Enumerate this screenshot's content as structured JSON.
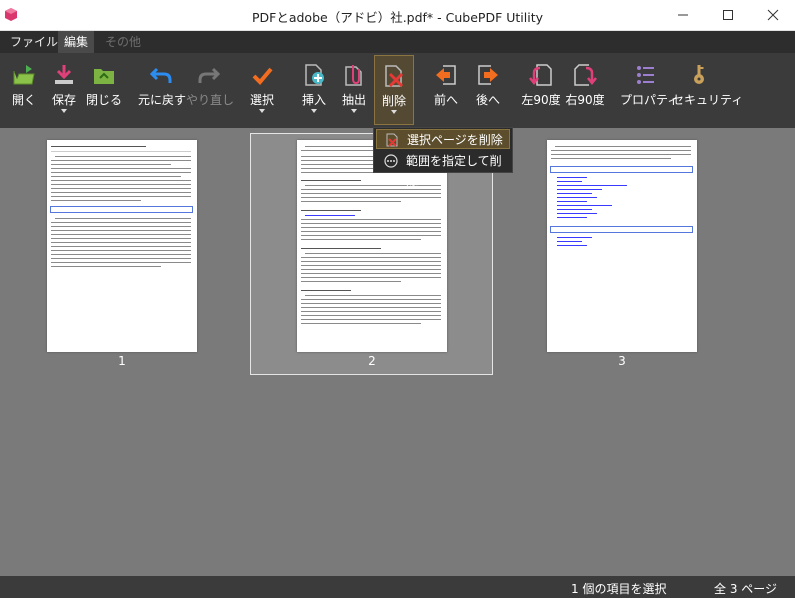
{
  "window": {
    "title": "PDFとadobe（アドビ）社.pdf* - CubePDF Utility",
    "minimize_icon": "minimize-icon",
    "maximize_icon": "maximize-icon",
    "close_icon": "close-icon"
  },
  "menubar": {
    "items": [
      {
        "label": "ファイル"
      },
      {
        "label": "編集"
      },
      {
        "label": "その他"
      }
    ]
  },
  "ribbon": {
    "open": "開く",
    "save": "保存",
    "close": "閉じる",
    "undo": "元に戻す",
    "redo": "やり直し",
    "select": "選択",
    "insert": "挿入",
    "extract": "抽出",
    "delete": "削除",
    "move_prev": "前へ",
    "move_next": "後へ",
    "rotate_left": "左90度",
    "rotate_right": "右90度",
    "properties": "プロパティ",
    "security": "セキュリティ"
  },
  "colors": {
    "accent_orange": "#f26d1f",
    "accent_green": "#4caf50",
    "accent_blue": "#2d8cf0",
    "accent_pink": "#e0407a",
    "accent_teal": "#49b8c9",
    "ribbon_bg": "#3b3b3b",
    "content_bg": "#7a7a7a"
  },
  "dropdown": {
    "items": [
      {
        "label": "選択ページを削除",
        "icon": "delete-page-icon"
      },
      {
        "label": "範囲を指定して削除",
        "icon": "more-dots-icon"
      }
    ]
  },
  "pages": [
    {
      "number": "1",
      "selected": false
    },
    {
      "number": "2",
      "selected": true
    },
    {
      "number": "3",
      "selected": false
    }
  ],
  "status": {
    "selection": "1 個の項目を選択",
    "total": "全 3 ページ"
  }
}
